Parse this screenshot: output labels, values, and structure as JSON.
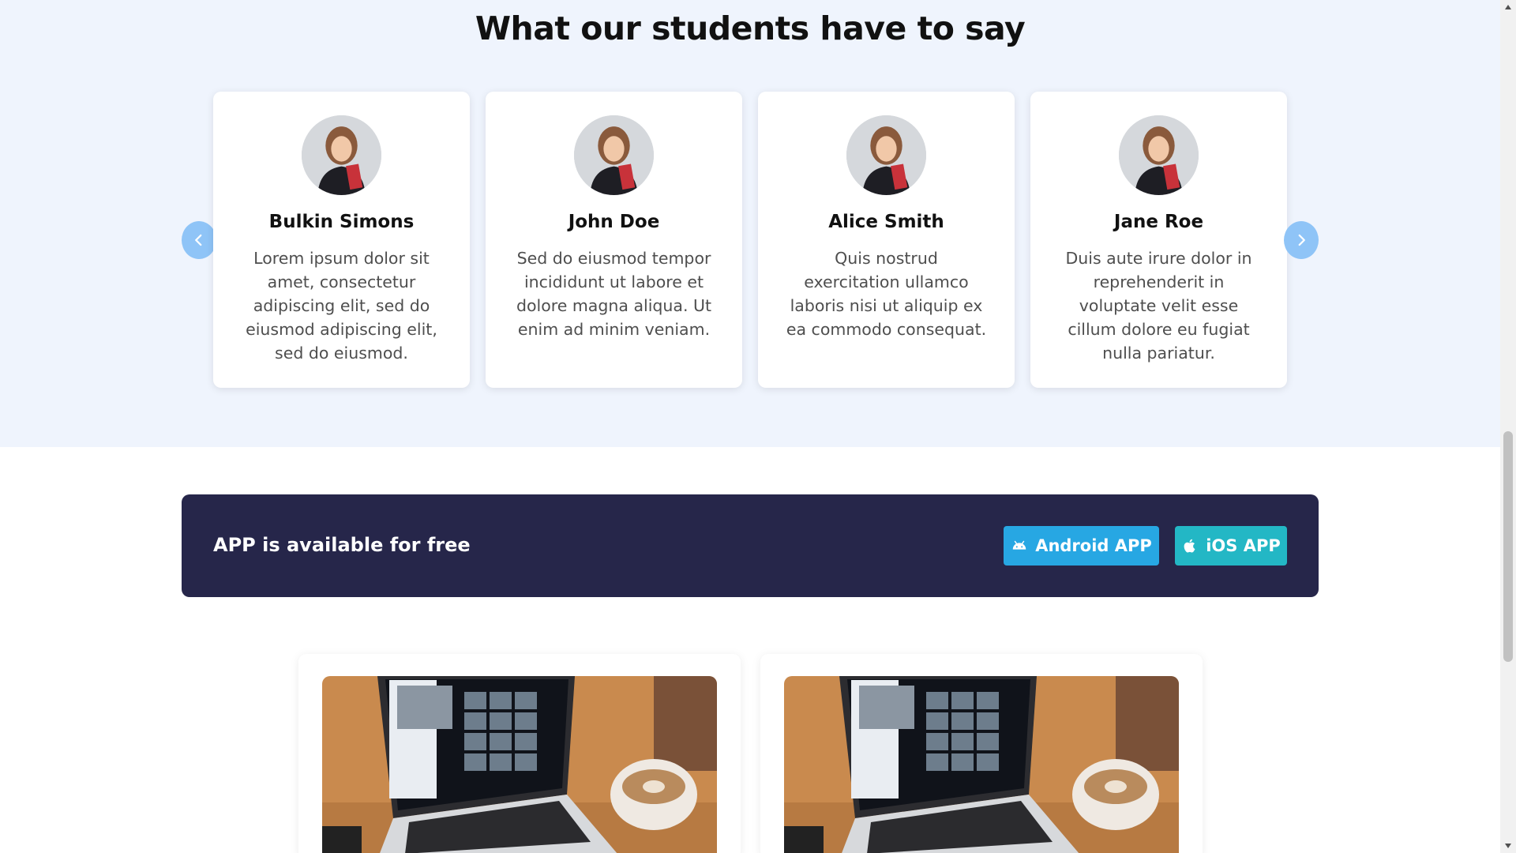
{
  "testimonials": {
    "title": "What our students have to say",
    "cards": [
      {
        "name": "Bulkin Simons",
        "text": "Lorem ipsum dolor sit amet, consectetur adipiscing elit, sed do eiusmod adipiscing elit, sed do eiusmod."
      },
      {
        "name": "John Doe",
        "text": "Sed do eiusmod tempor incididunt ut labore et dolore magna aliqua. Ut enim ad minim veniam."
      },
      {
        "name": "Alice Smith",
        "text": "Quis nostrud exercitation ullamco laboris nisi ut aliquip ex ea commodo consequat."
      },
      {
        "name": "Jane Roe",
        "text": "Duis aute irure dolor in reprehenderit in voluptate velit esse cillum dolore eu fugiat nulla pariatur."
      }
    ],
    "prev_icon": "chevron-left-icon",
    "next_icon": "chevron-right-icon"
  },
  "app_banner": {
    "text": "APP is available for free",
    "android_label": "Android APP",
    "ios_label": "iOS APP",
    "android_icon": "android-icon",
    "ios_icon": "apple-icon"
  },
  "colors": {
    "section_bg": "#eff4fd",
    "banner_bg": "#26264a",
    "android_btn": "#27a7e3",
    "ios_btn": "#23b7c5",
    "nav_arrow": "#8fc4f7"
  }
}
